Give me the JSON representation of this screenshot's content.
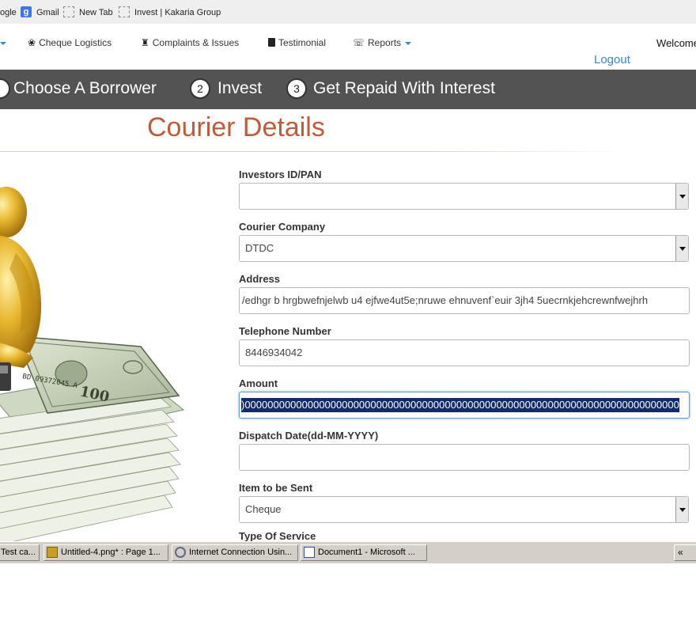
{
  "bookmarks": [
    {
      "label": "ogle",
      "icon": "none"
    },
    {
      "label": "Gmail",
      "icon": "google-icon"
    },
    {
      "label": "New Tab",
      "icon": "blank-page-icon"
    },
    {
      "label": "Invest | Kakaria Group",
      "icon": "blank-page-icon"
    }
  ],
  "nav": {
    "items": [
      {
        "label": "Cheque Logistics",
        "icon": "leaf-icon"
      },
      {
        "label": "Complaints & Issues",
        "icon": "chess-rook-icon"
      },
      {
        "label": "Testimonial",
        "icon": "book-icon"
      },
      {
        "label": "Reports",
        "icon": "phone-icon",
        "has_dropdown": true
      }
    ],
    "welcome": "Welcome",
    "logout": "Logout"
  },
  "steps": [
    {
      "number": "",
      "label": "Choose A Borrower"
    },
    {
      "number": "2",
      "label": "Invest"
    },
    {
      "number": "3",
      "label": "Get Repaid With Interest"
    }
  ],
  "page": {
    "heading": "Courier Details"
  },
  "form": {
    "investor_id": {
      "label": "Investors ID/PAN",
      "value": ""
    },
    "courier_company": {
      "label": "Courier Company",
      "value": "DTDC"
    },
    "address": {
      "label": "Address",
      "value": "/edhgr b hrgbwefnjelwb u4 ejfwe4ut5e;nruwe  ehnuvenf`euir 3jh4 5uecrnkjehcrewnfwejhrh"
    },
    "telephone": {
      "label": "Telephone Number",
      "value": "8446934042"
    },
    "amount": {
      "label": "Amount",
      "value": ")0000000000000000000000000000000000000000000000000000000000000000000000000000"
    },
    "dispatch_date": {
      "label": "Dispatch Date(dd-MM-YYYY)",
      "value": ""
    },
    "item": {
      "label": "Item to be Sent",
      "value": "Cheque"
    },
    "service_type": {
      "label": "Type Of Service"
    }
  },
  "taskbar": {
    "tasks": [
      {
        "label": "Test ca...",
        "icon": "app-icon"
      },
      {
        "label": "Untitled-4.png* : Page 1...",
        "icon": "fireworks-icon"
      },
      {
        "label": "Internet Connection Usin...",
        "icon": "network-icon"
      },
      {
        "label": "Document1 - Microsoft ...",
        "icon": "word-icon"
      }
    ],
    "tray_label": "«"
  },
  "colors": {
    "accent": "#3a87c8",
    "heading": "#c25a37",
    "steps_bar": "#535353",
    "selection": "#112b6e"
  }
}
